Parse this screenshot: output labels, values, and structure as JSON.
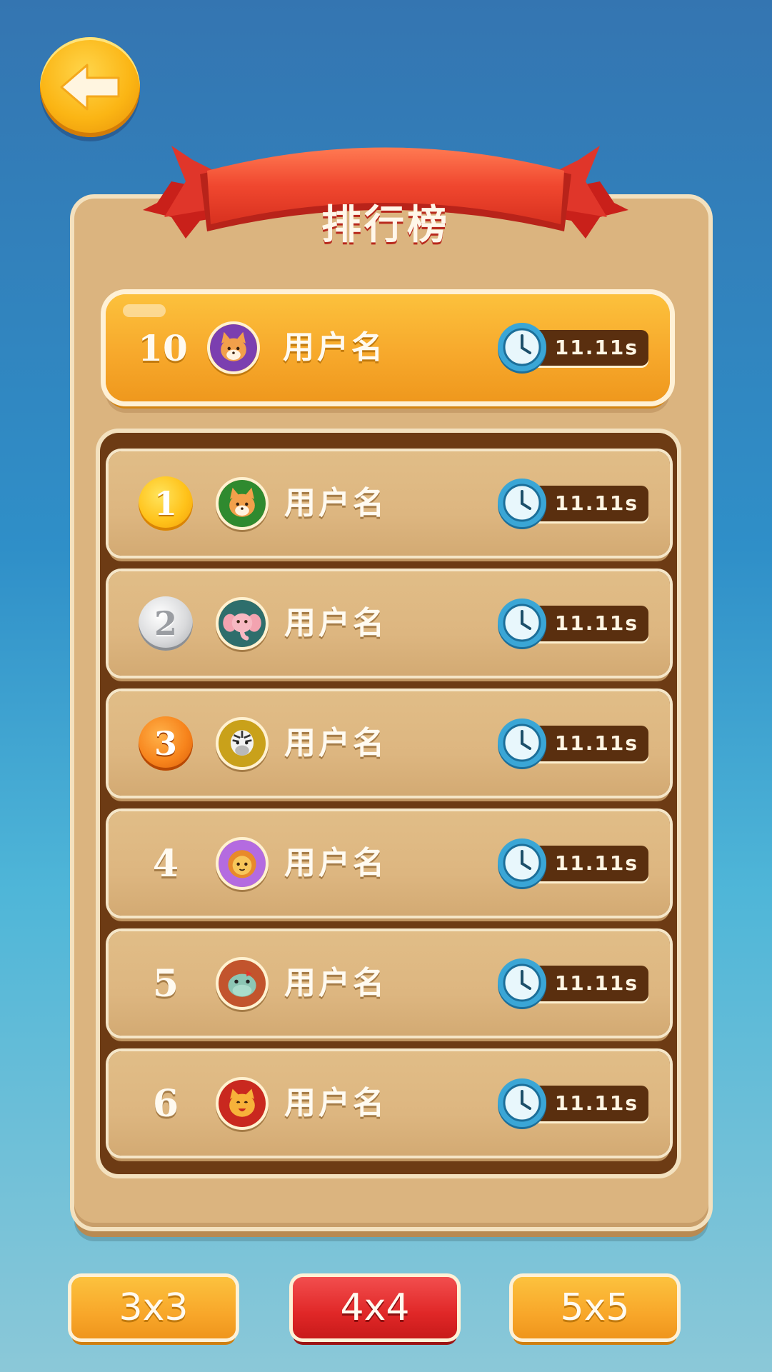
{
  "header": {
    "title": "排行榜"
  },
  "my_entry": {
    "rank": "10",
    "username": "用户名",
    "time": "11.11s",
    "avatar_icon": "fox-avatar-icon",
    "avatar_color": "#7b3fb0"
  },
  "entries": [
    {
      "rank": "1",
      "rank_style": "gold-medal",
      "username": "用户名",
      "time": "11.11s",
      "avatar_icon": "fox-avatar-icon",
      "avatar_color": "#2f8a2f"
    },
    {
      "rank": "2",
      "rank_style": "silver-medal",
      "username": "用户名",
      "time": "11.11s",
      "avatar_icon": "elephant-avatar-icon",
      "avatar_color": "#2e6e6c"
    },
    {
      "rank": "3",
      "rank_style": "bronze-medal",
      "username": "用户名",
      "time": "11.11s",
      "avatar_icon": "zebra-avatar-icon",
      "avatar_color": "#c9a11a"
    },
    {
      "rank": "4",
      "rank_style": "plain",
      "username": "用户名",
      "time": "11.11s",
      "avatar_icon": "lion-avatar-icon",
      "avatar_color": "#b46be0"
    },
    {
      "rank": "5",
      "rank_style": "plain",
      "username": "用户名",
      "time": "11.11s",
      "avatar_icon": "hippo-avatar-icon",
      "avatar_color": "#c2542d"
    },
    {
      "rank": "6",
      "rank_style": "plain",
      "username": "用户名",
      "time": "11.11s",
      "avatar_icon": "cat-avatar-icon",
      "avatar_color": "#c9281f"
    }
  ],
  "modes": [
    {
      "label": "3x3",
      "selected": false
    },
    {
      "label": "4x4",
      "selected": true
    },
    {
      "label": "5x5",
      "selected": false
    }
  ],
  "icons": {
    "back": "back-arrow-icon",
    "timer": "clock-icon"
  },
  "colors": {
    "accent_orange": "#f8a72a",
    "accent_red": "#e02727",
    "board": "#dbb47f",
    "frame": "#6d3b14"
  }
}
